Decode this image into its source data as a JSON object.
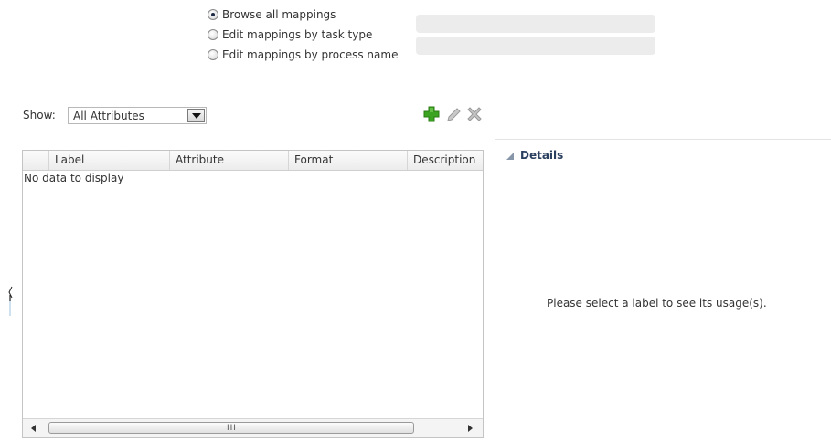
{
  "mapping_mode": {
    "options": [
      {
        "label": "Browse all mappings",
        "selected": true
      },
      {
        "label": "Edit mappings by task type",
        "selected": false
      },
      {
        "label": "Edit mappings by process name",
        "selected": false
      }
    ]
  },
  "filter": {
    "show_label": "Show:",
    "selected_value": "All Attributes"
  },
  "toolbar": {
    "icons": [
      "add-icon",
      "edit-icon",
      "delete-icon"
    ],
    "colors": {
      "add": "#3aa320",
      "edit": "#a6a6a6",
      "delete": "#a6a6a6"
    }
  },
  "table": {
    "columns": [
      "Label",
      "Attribute",
      "Format",
      "Description"
    ],
    "rows": [],
    "empty_message": "No data to display",
    "scrollbar_grip": "III"
  },
  "details": {
    "title": "Details",
    "message": "Please select a label to see its usage(s)."
  }
}
